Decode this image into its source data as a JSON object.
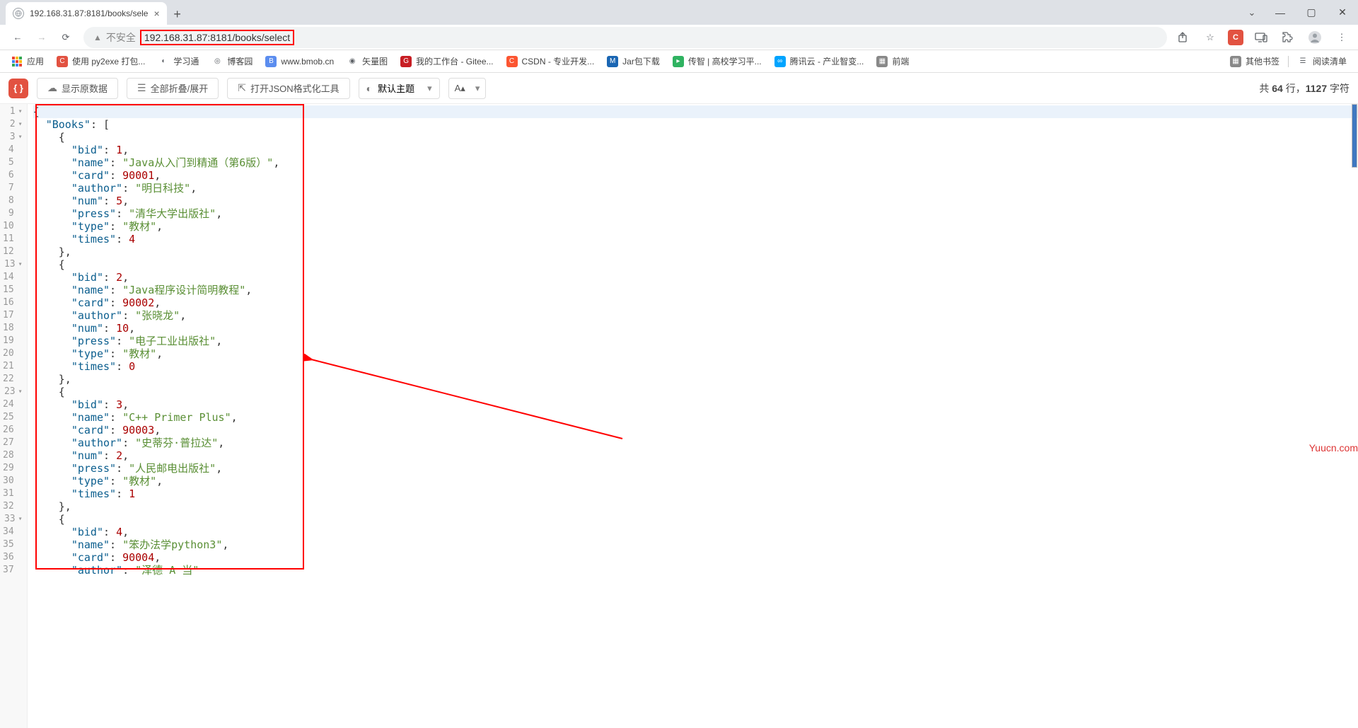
{
  "tab": {
    "title": "192.168.31.87:8181/books/sele"
  },
  "address": {
    "insecure_label": "不安全",
    "url": "192.168.31.87:8181/books/select"
  },
  "bookmarks": {
    "apps": "应用",
    "items": [
      {
        "label": "使用 py2exe 打包...",
        "color": "#e25241",
        "initial": "C"
      },
      {
        "label": "学习通",
        "color": "transparent",
        "initial": "◐"
      },
      {
        "label": "博客园",
        "color": "transparent",
        "initial": "◎"
      },
      {
        "label": "www.bmob.cn",
        "color": "#5b8def",
        "initial": "B"
      },
      {
        "label": "矢量图",
        "color": "transparent",
        "initial": "◉"
      },
      {
        "label": "我的工作台 - Gitee...",
        "color": "#c71d23",
        "initial": "G"
      },
      {
        "label": "CSDN - 专业开发...",
        "color": "#fc5531",
        "initial": "C"
      },
      {
        "label": "Jar包下载",
        "color": "#1a66b3",
        "initial": "M"
      },
      {
        "label": "传智 | 高校学习平...",
        "color": "#2fb361",
        "initial": "▸"
      },
      {
        "label": "腾讯云 - 产业智变...",
        "color": "#00a4ff",
        "initial": "∞"
      },
      {
        "label": "前端",
        "color": "#888",
        "initial": "▦"
      }
    ],
    "other": "其他书签",
    "reading": "阅读清单"
  },
  "toolbar": {
    "raw": "显示原数据",
    "fold": "全部折叠/展开",
    "open_tool": "打开JSON格式化工具",
    "theme": "默认主题",
    "font_label": "A",
    "stats_prefix": "共 ",
    "stats_lines": "64",
    "stats_lines_suffix": " 行，",
    "stats_chars": "1127",
    "stats_chars_suffix": " 字符"
  },
  "json_data": {
    "Books": [
      {
        "bid": 1,
        "name": "Java从入门到精通（第6版）",
        "card": 90001,
        "author": "明日科技",
        "num": 5,
        "press": "清华大学出版社",
        "type": "教材",
        "times": 4
      },
      {
        "bid": 2,
        "name": "Java程序设计简明教程",
        "card": 90002,
        "author": "张晓龙",
        "num": 10,
        "press": "电子工业出版社",
        "type": "教材",
        "times": 0
      },
      {
        "bid": 3,
        "name": "C++ Primer Plus",
        "card": 90003,
        "author": "史蒂芬·普拉达",
        "num": 2,
        "press": "人民邮电出版社",
        "type": "教材",
        "times": 1
      },
      {
        "bid": 4,
        "name": "笨办法学python3",
        "card": 90004,
        "author_partial": "泽德 A 当"
      }
    ]
  },
  "watermark": "Yuucn.com"
}
